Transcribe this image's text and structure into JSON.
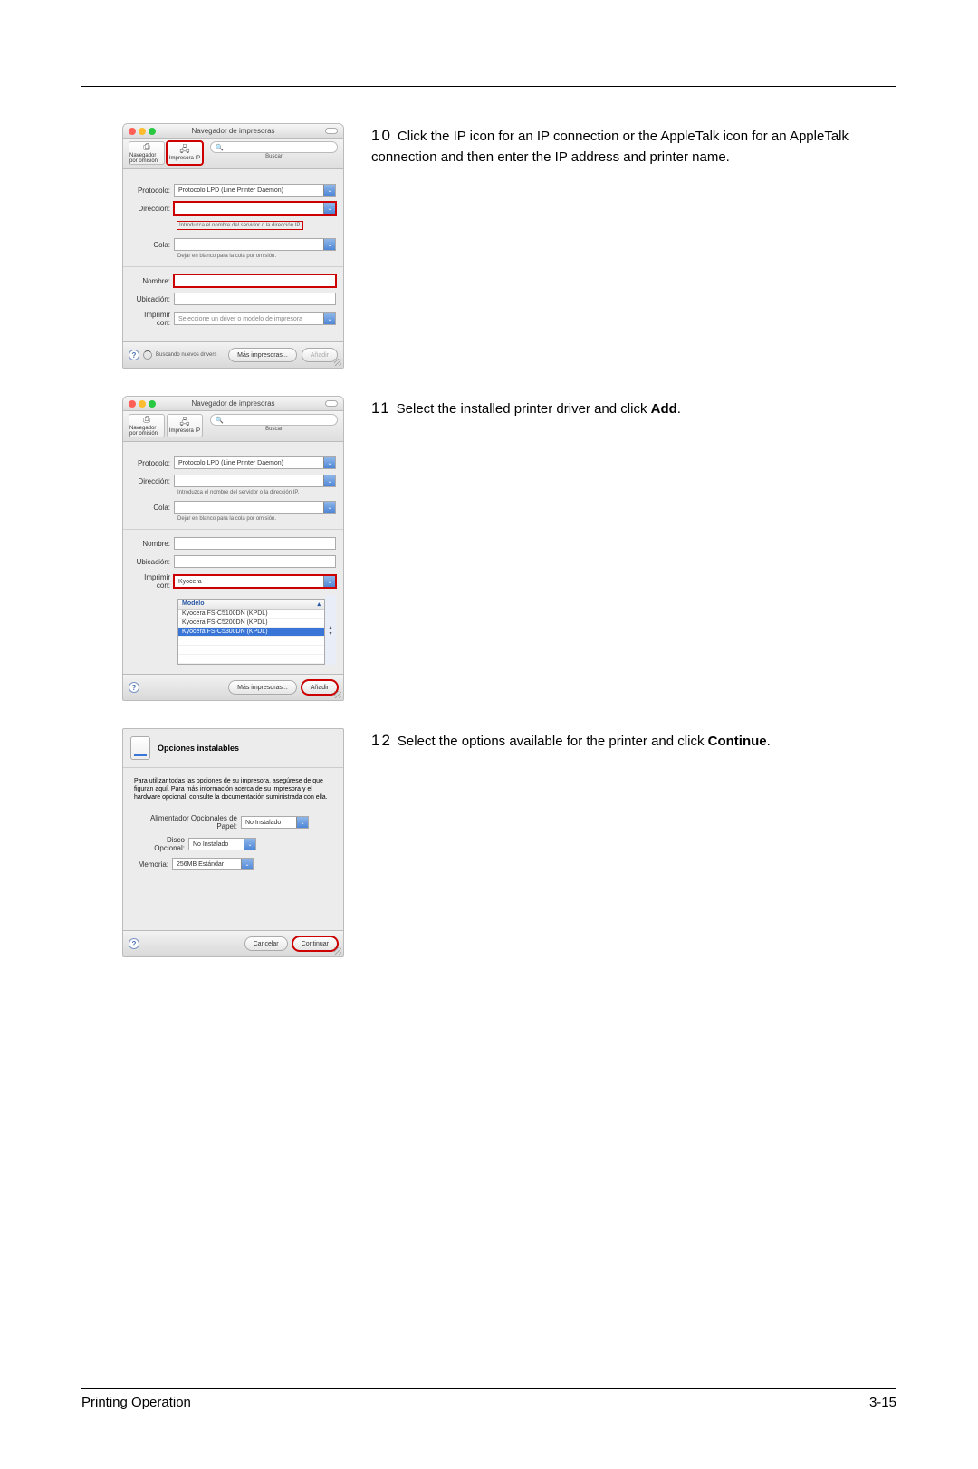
{
  "page": {
    "footer_left": "Printing Operation",
    "footer_right": "3-15"
  },
  "steps": [
    {
      "num": "10",
      "text": "Click the IP icon for an IP connection or the AppleTalk icon for an AppleTalk connection and then enter the IP address and printer name."
    },
    {
      "num": "11",
      "text_a": "Select the installed printer driver and click ",
      "bold": "Add",
      "text_b": "."
    },
    {
      "num": "12",
      "text_a": "Select the options available for the printer and click ",
      "bold": "Continue",
      "text_b": "."
    }
  ],
  "win": {
    "title": "Navegador de impresoras",
    "tb_default": "Navegador por omisión",
    "tb_ip": "Impresora IP",
    "search_lbl": "Buscar",
    "protocolo_lbl": "Protocolo:",
    "protocolo_val": "Protocolo LPD (Line Printer Daemon)",
    "direccion_lbl": "Dirección:",
    "direccion_hint": "Introduzca el nombre del servidor o la dirección IP.",
    "cola_lbl": "Cola:",
    "cola_hint": "Dejar en blanco para la cola por omisión.",
    "nombre_lbl": "Nombre:",
    "ubic_lbl": "Ubicación:",
    "print_lbl": "Imprimir con:",
    "print_val1": "Seleccione un driver o modelo de impresora",
    "print_val2": "Kyocera",
    "status": "Buscando nuevos drivers",
    "mas": "Más impresoras...",
    "anadir": "Añadir",
    "modelo_hdr": "Modelo",
    "models": [
      "Kyocera FS-C5100DN (KPDL)",
      "Kyocera FS-C5200DN (KPDL)",
      "Kyocera FS-C5300DN (KPDL)"
    ]
  },
  "modal": {
    "title": "Opciones instalables",
    "msg": "Para utilizar todas las opciones de su impresora, asegúrese de que figuran aquí. Para más información acerca de su impresora y el hardware opcional, consulte la documentación suministrada con ella.",
    "feeder_lbl": "Alimentador Opcionales de Papel:",
    "feeder_val": "No Instalado",
    "disk_lbl": "Disco Opcional:",
    "disk_val": "No Instalado",
    "mem_lbl": "Memoria:",
    "mem_val": "256MB Estándar",
    "cancel": "Cancelar",
    "cont": "Continuar"
  }
}
